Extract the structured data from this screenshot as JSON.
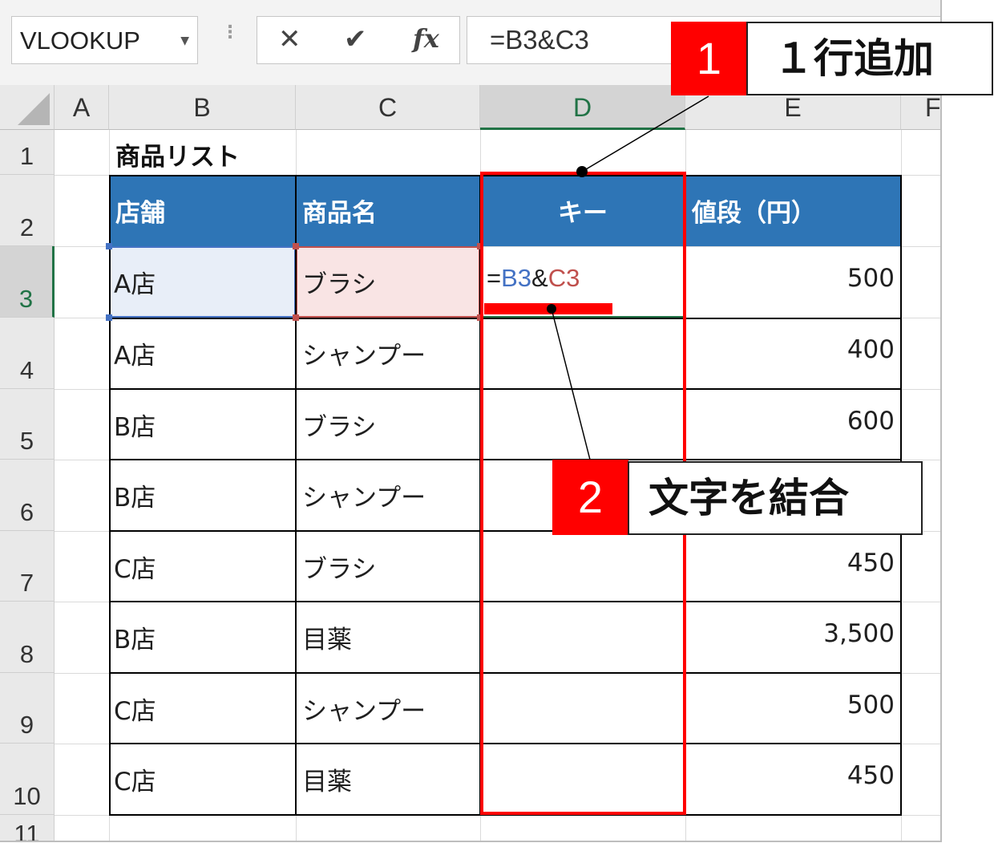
{
  "formula_bar": {
    "name_box": "VLOOKUP",
    "cancel_icon": "✕",
    "enter_icon": "✔",
    "fx_label": "fx",
    "formula": "=B3&C3"
  },
  "columns": [
    "A",
    "B",
    "C",
    "D",
    "E",
    "F"
  ],
  "rows": [
    "1",
    "2",
    "3",
    "4",
    "5",
    "6",
    "7",
    "8",
    "9",
    "10",
    "11"
  ],
  "sheet": {
    "title": "商品リスト",
    "headers": [
      "店舗",
      "商品名",
      "キー",
      "値段（円）"
    ],
    "editing_cell": {
      "eq": "=",
      "ref1": "B3",
      "amp": "&",
      "ref2": "C3"
    },
    "data_rows": [
      {
        "store": "A店",
        "product": "ブラシ",
        "price": "500"
      },
      {
        "store": "A店",
        "product": "シャンプー",
        "price": "400"
      },
      {
        "store": "B店",
        "product": "ブラシ",
        "price": "600"
      },
      {
        "store": "B店",
        "product": "シャンプー",
        "price": ""
      },
      {
        "store": "C店",
        "product": "ブラシ",
        "price": "450"
      },
      {
        "store": "B店",
        "product": "目薬",
        "price": "3,500"
      },
      {
        "store": "C店",
        "product": "シャンプー",
        "price": "500"
      },
      {
        "store": "C店",
        "product": "目薬",
        "price": "450"
      }
    ]
  },
  "annotations": {
    "callout1": {
      "number": "1",
      "text": "１行追加"
    },
    "callout2": {
      "number": "2",
      "text": "文字を結合"
    }
  },
  "colors": {
    "header_fill": "#2e75b6",
    "ref1_color": "#4472c4",
    "ref2_color": "#c0504d",
    "annotation_red": "#ff0000",
    "active_green": "#217346"
  }
}
